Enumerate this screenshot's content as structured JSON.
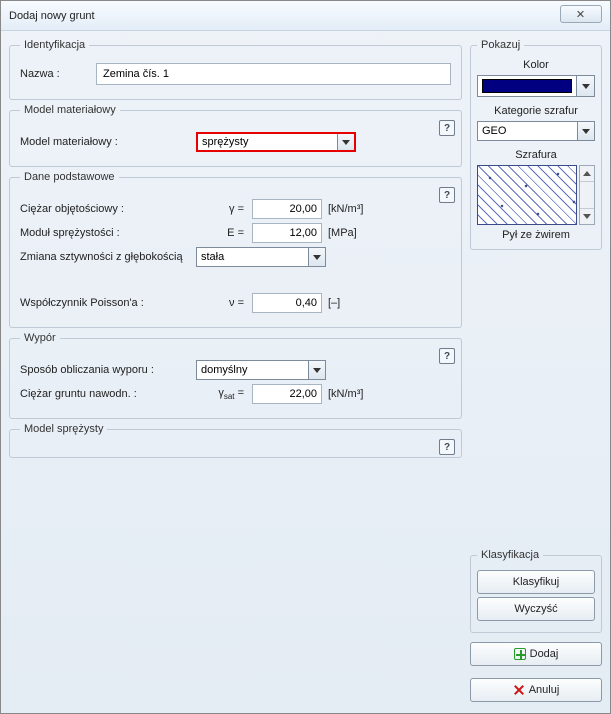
{
  "window": {
    "title": "Dodaj nowy grunt",
    "close": "✕"
  },
  "ident": {
    "legend": "Identyfikacja",
    "name_lbl": "Nazwa :",
    "name_val": "Zemina čís. 1"
  },
  "model": {
    "legend": "Model materiałowy",
    "mat_lbl": "Model materiałowy :",
    "mat_val": "sprężysty"
  },
  "basic": {
    "legend": "Dane podstawowe",
    "unit_weight_lbl": "Ciężar objętościowy :",
    "unit_weight_sym": "γ =",
    "unit_weight_val": "20,00",
    "unit_weight_unit": "[kN/m³]",
    "emod_lbl": "Moduł sprężystości :",
    "emod_sym": "E =",
    "emod_val": "12,00",
    "emod_unit": "[MPa]",
    "stiff_lbl": "Zmiana sztywności z głębokością",
    "stiff_val": "stała",
    "poisson_lbl": "Współczynnik Poisson'a :",
    "poisson_sym": "ν =",
    "poisson_val": "0,40",
    "poisson_unit": "[–]"
  },
  "uplift": {
    "legend": "Wypór",
    "calc_lbl": "Sposób obliczania wyporu :",
    "calc_val": "domyślny",
    "sat_lbl": "Ciężar gruntu nawodn. :",
    "sat_sym": "γsat =",
    "sat_val": "22,00",
    "sat_unit": "[kN/m³]"
  },
  "elastic": {
    "legend": "Model sprężysty"
  },
  "show": {
    "legend": "Pokazuj",
    "color_lbl": "Kolor",
    "color_hex": "#000080",
    "cat_lbl": "Kategorie szrafur",
    "cat_val": "GEO",
    "hatch_lbl": "Szrafura",
    "hatch_name": "Pył ze żwirem"
  },
  "class": {
    "legend": "Klasyfikacja",
    "classify": "Klasyfikuj",
    "clear": "Wyczyść"
  },
  "actions": {
    "add": "Dodaj",
    "cancel": "Anuluj"
  },
  "help": "?"
}
